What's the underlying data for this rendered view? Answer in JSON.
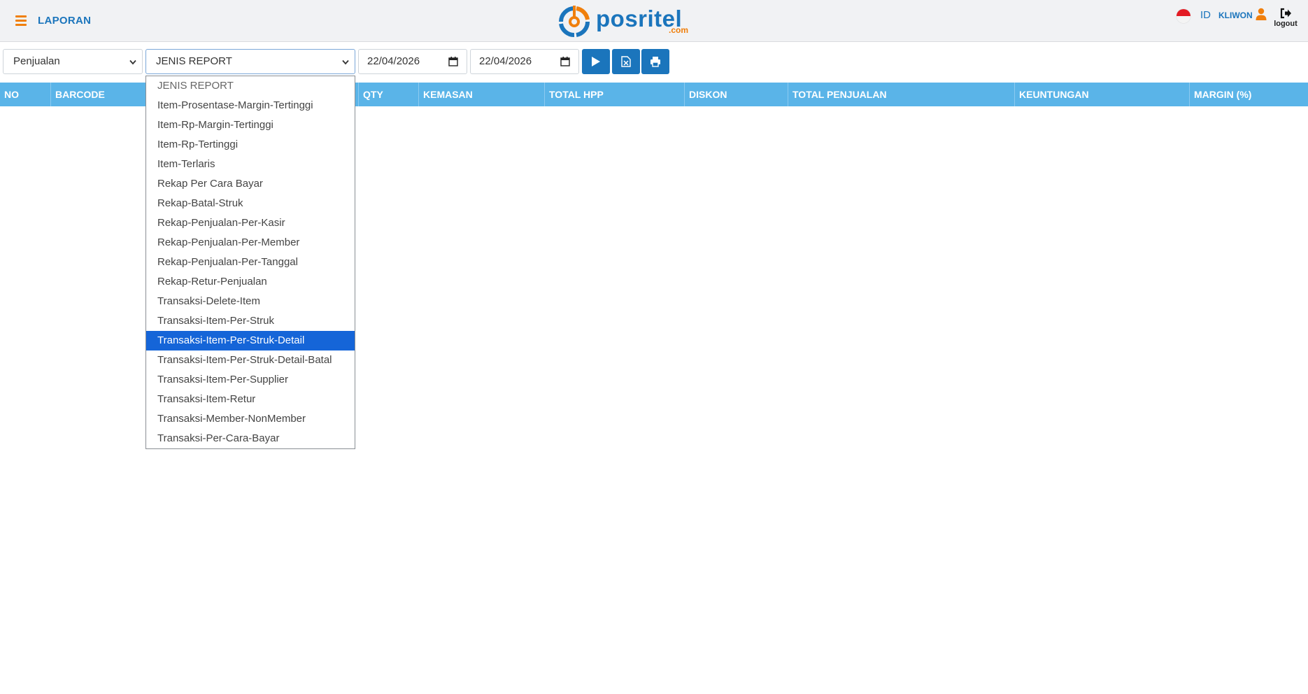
{
  "header": {
    "title": "LAPORAN",
    "logo_text": "posritel",
    "logo_suffix": ".com",
    "lang": "ID",
    "username": "KLIWON",
    "logout_label": "logout"
  },
  "toolbar": {
    "category_select": "Penjualan",
    "report_select": "JENIS REPORT",
    "date_from": "22/04/2026",
    "date_to": "22/04/2026"
  },
  "table": {
    "columns": [
      "NO",
      "BARCODE",
      "QTY",
      "KEMASAN",
      "TOTAL HPP",
      "DISKON",
      "TOTAL PENJUALAN",
      "KEUNTUNGAN",
      "MARGIN (%)"
    ]
  },
  "dropdown": {
    "selected_index": 14,
    "options": [
      "JENIS REPORT",
      "Item-Prosentase-Margin-Tertinggi",
      "Item-Rp-Margin-Tertinggi",
      "Item-Rp-Tertinggi",
      "Item-Terlaris",
      "Rekap Per Cara Bayar",
      "Rekap-Batal-Struk",
      "Rekap-Penjualan-Per-Kasir",
      "Rekap-Penjualan-Per-Member",
      "Rekap-Penjualan-Per-Tanggal",
      "Rekap-Retur-Penjualan",
      "Transaksi-Delete-Item",
      "Transaksi-Item-Per-Struk",
      "Transaksi-Item-Per-Struk-Detail",
      "Transaksi-Item-Per-Struk-Detail-Batal",
      "Transaksi-Item-Per-Supplier",
      "Transaksi-Item-Retur",
      "Transaksi-Member-NonMember",
      "Transaksi-Per-Cara-Bayar"
    ]
  },
  "colors": {
    "brand_blue": "#1b75bc",
    "brand_orange": "#f07f0c",
    "table_header": "#5ab4e8",
    "selected_option": "#1565d8"
  }
}
